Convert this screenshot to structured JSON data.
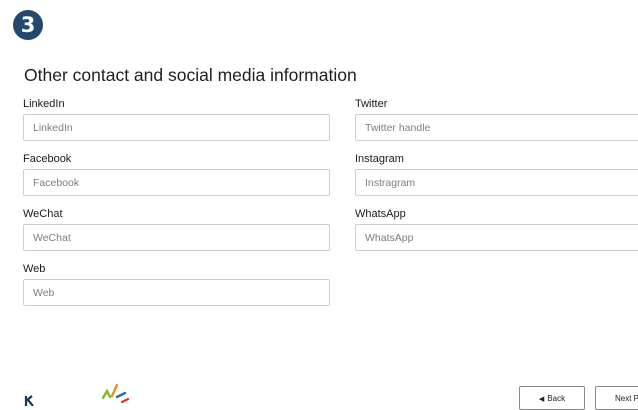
{
  "step": {
    "number": "3"
  },
  "section": {
    "title": "Other contact and social media information"
  },
  "fields": {
    "linkedin": {
      "label": "LinkedIn",
      "placeholder": "LinkedIn",
      "value": ""
    },
    "twitter": {
      "label": "Twitter",
      "placeholder": "Twitter handle",
      "value": ""
    },
    "facebook": {
      "label": "Facebook",
      "placeholder": "Facebook",
      "value": ""
    },
    "instagram": {
      "label": "Instagram",
      "placeholder": "Instragram",
      "value": ""
    },
    "wechat": {
      "label": "WeChat",
      "placeholder": "WeChat",
      "value": ""
    },
    "whatsapp": {
      "label": "WhatsApp",
      "placeholder": "WhatsApp",
      "value": ""
    },
    "web": {
      "label": "Web",
      "placeholder": "Web",
      "value": ""
    }
  },
  "footer": {
    "back_label": "Back",
    "back_arrow_icon": "triangle-left-icon",
    "next_label": "Next Page"
  },
  "colors": {
    "badge": "#24486e",
    "input_border": "#cfcfcf",
    "logo_green": "#7dbb2c",
    "logo_orange": "#f28c1c",
    "logo_blue": "#2d6bb5",
    "logo_dark": "#1f3556"
  }
}
